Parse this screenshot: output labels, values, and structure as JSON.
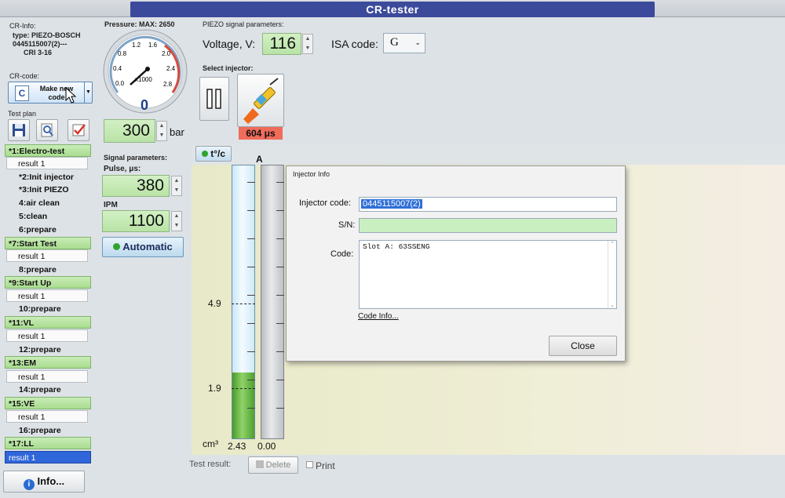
{
  "window": {
    "title": "CR-tester"
  },
  "cr_info": {
    "heading": "CR-Info:",
    "type": "type: PIEZO-BOSCH",
    "part": "0445115007(2)---",
    "cri": "CRI 3-16"
  },
  "cr_code": {
    "heading": "CR-code:",
    "button_label": "Make new code",
    "icon_letter": "C"
  },
  "test_plan": {
    "heading": "Test plan",
    "items": [
      {
        "label": "*1:Electro-test",
        "kind": "hl"
      },
      {
        "label": "result 1",
        "kind": "res"
      },
      {
        "label": "*2:Init injector",
        "kind": "txt"
      },
      {
        "label": "*3:Init PIEZO",
        "kind": "txt"
      },
      {
        "label": "4:air clean",
        "kind": "txt"
      },
      {
        "label": "5:clean",
        "kind": "txt"
      },
      {
        "label": "6:prepare",
        "kind": "txt"
      },
      {
        "label": "*7:Start Test",
        "kind": "hl"
      },
      {
        "label": "result 1",
        "kind": "res"
      },
      {
        "label": "8:prepare",
        "kind": "txt"
      },
      {
        "label": "*9:Start Up",
        "kind": "hl"
      },
      {
        "label": "result 1",
        "kind": "res"
      },
      {
        "label": "10:prepare",
        "kind": "txt"
      },
      {
        "label": "*11:VL",
        "kind": "hl"
      },
      {
        "label": "result 1",
        "kind": "res"
      },
      {
        "label": "12:prepare",
        "kind": "txt"
      },
      {
        "label": "*13:EM",
        "kind": "hl"
      },
      {
        "label": "result 1",
        "kind": "res"
      },
      {
        "label": "14:prepare",
        "kind": "txt"
      },
      {
        "label": "*15:VE",
        "kind": "hl"
      },
      {
        "label": "result 1",
        "kind": "res"
      },
      {
        "label": "16:prepare",
        "kind": "txt"
      },
      {
        "label": "*17:LL",
        "kind": "hl"
      },
      {
        "label": "result 1",
        "kind": "sel"
      }
    ],
    "info_button": "Info..."
  },
  "pressure": {
    "heading": "Pressure: MAX: 2650",
    "gauge_labels": [
      "0.4",
      "0.8",
      "1.2",
      "1.6",
      "2.0",
      "2.4",
      "2.8",
      "0.0"
    ],
    "gauge_multiplier": "x1000",
    "gauge_reading": "0",
    "setpoint": "300",
    "unit": "bar"
  },
  "signal": {
    "heading": "Signal parameters:",
    "pulse_label": "Pulse, μs:",
    "pulse_value": "380",
    "ipm_label": "IPM",
    "ipm_value": "1100",
    "mode_button": "Automatic"
  },
  "piezo": {
    "heading": "PIEZO signal parameters:",
    "voltage_label": "Voltage, V:",
    "voltage_value": "116",
    "isa_label": "ISA code:",
    "isa_value": "G"
  },
  "injector_select": {
    "heading": "Select injector:",
    "time_badge": "604 μs"
  },
  "measure": {
    "temp_button": "t°/c",
    "column_a_label": "A",
    "scale_labels": [
      "4.9",
      "1.9"
    ],
    "unit": "cm³",
    "value_left": "2.43",
    "value_right": "0.00",
    "fill_fraction": 0.24
  },
  "footer": {
    "test_result_label": "Test result:",
    "delete_button": "Delete",
    "print_label": "Print"
  },
  "dialog": {
    "title": "Injector Info",
    "injector_code_label": "Injector code:",
    "injector_code_value": "0445115007(2)",
    "sn_label": "S/N:",
    "sn_value": "",
    "code_label": "Code:",
    "code_value": "Slot A: 63SSENG",
    "code_info_link": "Code Info...",
    "close_button": "Close"
  },
  "colors": {
    "accent_green": "#a9dc90",
    "selection_blue": "#2f66d9",
    "badge_red": "#ef6b5a"
  }
}
